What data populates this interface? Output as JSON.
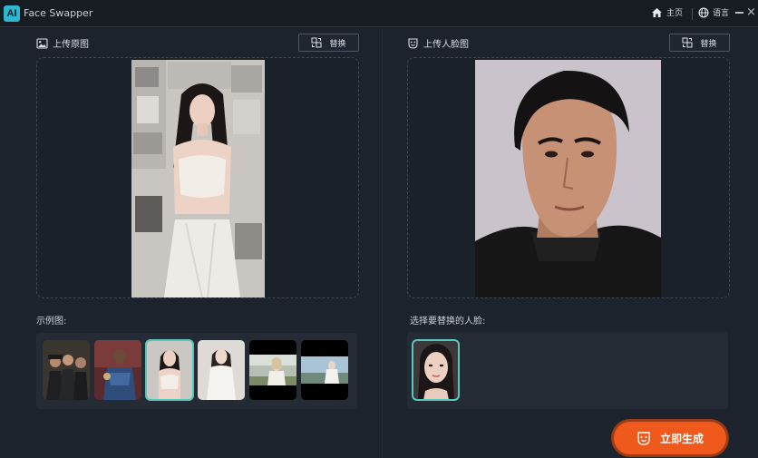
{
  "app": {
    "logo_text": "AI",
    "title": "Face Swapper"
  },
  "titlebar": {
    "home_label": "主页",
    "language_label": "语言",
    "close_glyph": "×"
  },
  "source_panel": {
    "title": "上传原图",
    "swap_label": "替换",
    "examples_label": "示例图:",
    "thumbnails": [
      "men-in-suits",
      "soldier-in-armor",
      "woman-white-top",
      "woman-white-dress",
      "woman-in-field",
      "woman-on-beach"
    ]
  },
  "face_panel": {
    "title": "上传人脸图",
    "swap_label": "替换",
    "choose_label": "选择要替换的人脸:",
    "detected_faces": [
      "woman-face"
    ]
  },
  "generate_button": {
    "label": "立即生成"
  },
  "colors": {
    "accent": "#ef5a1c",
    "selected": "#58c6bd",
    "background": "#1d232c"
  }
}
